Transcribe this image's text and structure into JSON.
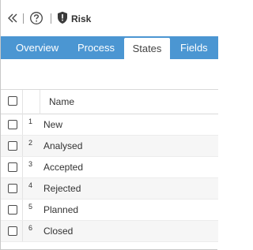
{
  "toolbar": {
    "title": "Risk",
    "icons": [
      "collapse-icon",
      "help-icon",
      "shield-icon"
    ]
  },
  "tabs": [
    {
      "label": "Overview",
      "active": false
    },
    {
      "label": "Process",
      "active": false
    },
    {
      "label": "States",
      "active": true
    },
    {
      "label": "Fields",
      "active": false
    }
  ],
  "grid": {
    "columns": {
      "name": "Name"
    },
    "rows": [
      {
        "index": "1",
        "name": "New"
      },
      {
        "index": "2",
        "name": "Analysed"
      },
      {
        "index": "3",
        "name": "Accepted"
      },
      {
        "index": "4",
        "name": "Rejected"
      },
      {
        "index": "5",
        "name": "Planned"
      },
      {
        "index": "6",
        "name": "Closed"
      }
    ]
  },
  "colors": {
    "tab_bar": "#4b96d2",
    "tab_text": "#ffffff",
    "active_tab_bg": "#ffffff",
    "row_alt": "#f6f6f6"
  }
}
